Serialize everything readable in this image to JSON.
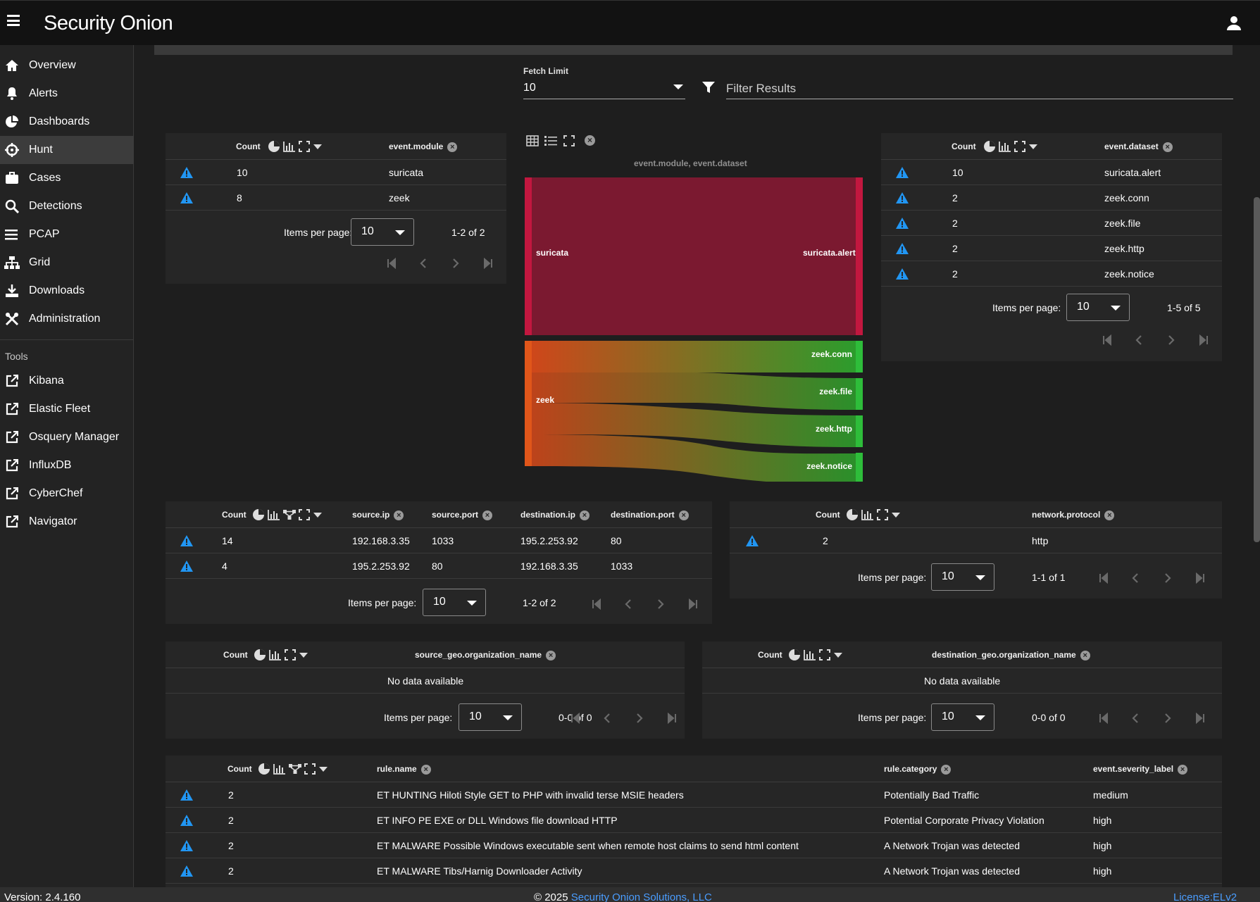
{
  "brand": {
    "name": "Security Onion"
  },
  "nav": {
    "items": [
      {
        "label": "Overview",
        "icon": "home-icon"
      },
      {
        "label": "Alerts",
        "icon": "bell-icon"
      },
      {
        "label": "Dashboards",
        "icon": "pie-chart-icon"
      },
      {
        "label": "Hunt",
        "icon": "crosshair-icon"
      },
      {
        "label": "Cases",
        "icon": "briefcase-icon"
      },
      {
        "label": "Detections",
        "icon": "search-icon"
      },
      {
        "label": "PCAP",
        "icon": "list-icon"
      },
      {
        "label": "Grid",
        "icon": "sitemap-icon"
      },
      {
        "label": "Downloads",
        "icon": "download-icon"
      },
      {
        "label": "Administration",
        "icon": "tools-icon"
      }
    ],
    "active": "Hunt",
    "tools_heading": "Tools",
    "tools": [
      "Kibana",
      "Elastic Fleet",
      "Osquery Manager",
      "InfluxDB",
      "CyberChef",
      "Navigator"
    ]
  },
  "fetch": {
    "label": "Fetch Limit",
    "value": "10"
  },
  "filter": {
    "placeholder": "Filter Results"
  },
  "common": {
    "count": "Count",
    "items_per_page": "Items per page:",
    "per_page_value": "10",
    "no_data": "No data available"
  },
  "module_table": {
    "field": "event.module",
    "rows": [
      {
        "count": "10",
        "value": "suricata"
      },
      {
        "count": "8",
        "value": "zeek"
      }
    ],
    "range": "1-2 of 2"
  },
  "dataset_table": {
    "field": "event.dataset",
    "rows": [
      {
        "count": "10",
        "value": "suricata.alert"
      },
      {
        "count": "2",
        "value": "zeek.conn"
      },
      {
        "count": "2",
        "value": "zeek.file"
      },
      {
        "count": "2",
        "value": "zeek.http"
      },
      {
        "count": "2",
        "value": "zeek.notice"
      }
    ],
    "range": "1-5 of 5"
  },
  "sankey": {
    "title": "event.module, event.dataset",
    "sources": [
      "suricata",
      "zeek"
    ],
    "targets": [
      "suricata.alert",
      "zeek.conn",
      "zeek.file",
      "zeek.http",
      "zeek.notice"
    ],
    "links": [
      {
        "from": "suricata",
        "to": "suricata.alert",
        "value": 10
      },
      {
        "from": "zeek",
        "to": "zeek.conn",
        "value": 2
      },
      {
        "from": "zeek",
        "to": "zeek.file",
        "value": 2
      },
      {
        "from": "zeek",
        "to": "zeek.http",
        "value": 2
      },
      {
        "from": "zeek",
        "to": "zeek.notice",
        "value": 2
      }
    ],
    "colors": {
      "suricata": "#c2173f",
      "zeek": "#e0561a",
      "green": "#2ebd3a"
    }
  },
  "conn_table": {
    "fields": [
      "source.ip",
      "source.port",
      "destination.ip",
      "destination.port"
    ],
    "rows": [
      {
        "count": "14",
        "source_ip": "192.168.3.35",
        "source_port": "1033",
        "dest_ip": "195.2.253.92",
        "dest_port": "80"
      },
      {
        "count": "4",
        "source_ip": "195.2.253.92",
        "source_port": "80",
        "dest_ip": "192.168.3.35",
        "dest_port": "1033"
      }
    ],
    "range": "1-2 of 2"
  },
  "proto_table": {
    "field": "network.protocol",
    "rows": [
      {
        "count": "2",
        "value": "http"
      }
    ],
    "range": "1-1 of 1"
  },
  "srcgeo_table": {
    "field": "source_geo.organization_name",
    "range": "0-0 of 0"
  },
  "dstgeo_table": {
    "field": "destination_geo.organization_name",
    "range": "0-0 of 0"
  },
  "rule_table": {
    "fields": [
      "rule.name",
      "rule.category",
      "event.severity_label"
    ],
    "rows": [
      {
        "count": "2",
        "name": "ET HUNTING Hiloti Style GET to PHP with invalid terse MSIE headers",
        "category": "Potentially Bad Traffic",
        "severity": "medium"
      },
      {
        "count": "2",
        "name": "ET INFO PE EXE or DLL Windows file download HTTP",
        "category": "Potential Corporate Privacy Violation",
        "severity": "high"
      },
      {
        "count": "2",
        "name": "ET MALWARE Possible Windows executable sent when remote host claims to send html content",
        "category": "A Network Trojan was detected",
        "severity": "high"
      },
      {
        "count": "2",
        "name": "ET MALWARE Tibs/Harnig Downloader Activity",
        "category": "A Network Trojan was detected",
        "severity": "high"
      }
    ]
  },
  "footer": {
    "version": "Version: 2.4.160",
    "copyright_prefix": "© 2025 ",
    "company": "Security Onion Solutions, LLC",
    "license": "License:ELv2"
  },
  "colors": {
    "accent": "#2196f3",
    "link": "#4a9dff"
  }
}
